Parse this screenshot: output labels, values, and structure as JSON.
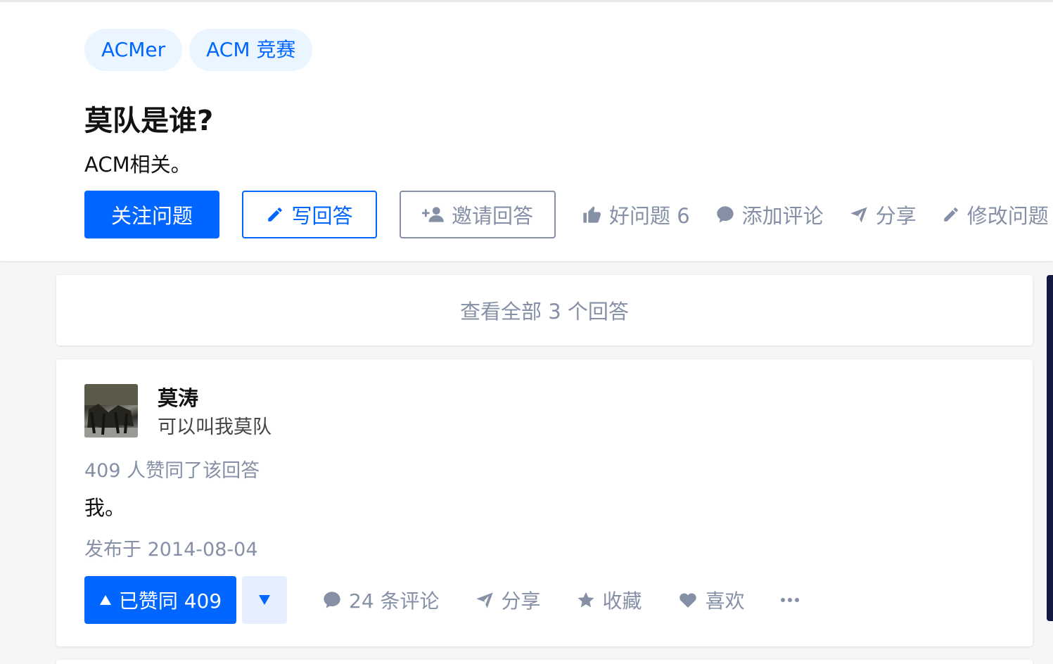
{
  "question": {
    "topics": [
      "ACMer",
      "ACM 竞赛"
    ],
    "title": "莫队是谁?",
    "detail": "ACM相关。",
    "actions": {
      "follow_label": "关注问题",
      "write_answer_label": "写回答",
      "invite_label": "邀请回答",
      "good_question_label": "好问题 6",
      "add_comment_label": "添加评论",
      "share_label": "分享",
      "edit_label": "修改问题"
    }
  },
  "view_all_label": "查看全部 3 个回答",
  "answer": {
    "author": {
      "name": "莫涛",
      "bio": "可以叫我莫队"
    },
    "vote_summary": "409 人赞同了该回答",
    "content": "我。",
    "publish_time": "发布于 2014-08-04",
    "actions": {
      "upvoted_label": "已赞同 409",
      "comments_label": "24 条评论",
      "share_label": "分享",
      "collect_label": "收藏",
      "like_label": "喜欢"
    }
  },
  "colors": {
    "brand_blue": "#0066ff",
    "secondary_gray": "#8590a6",
    "tag_background": "#ebf5ff"
  },
  "icons": [
    "pencil-icon",
    "add-user-icon",
    "thumbs-up-icon",
    "comment-icon",
    "paper-plane-icon",
    "pencil-icon",
    "triangle-up-icon",
    "triangle-down-icon",
    "star-icon",
    "heart-icon",
    "more-icon"
  ]
}
